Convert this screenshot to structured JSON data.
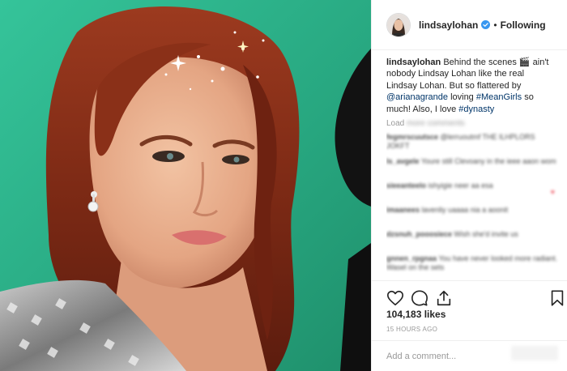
{
  "post": {
    "username": "lindsaylohan",
    "follow_status": "Following",
    "separator": "•",
    "verified_color": "#3897f0"
  },
  "caption": {
    "username": "lindsaylohan",
    "text_1": "Behind the scenes",
    "emoji": "🎬",
    "text_2": "ain't nobody Lindsay Lohan like the real Lindsay Lohan. But so flattered by",
    "mention": "@arianagrande",
    "text_3": "loving",
    "hashtag_1": "#MeanGirls",
    "text_4": "so much! Also, I love",
    "hashtag_2": "#dynasty"
  },
  "comments": {
    "load_label": "Load",
    "load_rest": "more comments",
    "items": [
      {
        "user": "fegmrscuutsce",
        "text": "@lerruoutmf THE ILHPLORS JOKFT"
      },
      {
        "user": "ls_avgele",
        "text": "Youre still Clevoany in the ieee aaon wom"
      },
      {
        "user": "sieeanteelo",
        "text": "ishyigie neer aa esa",
        "heart": "♥"
      },
      {
        "user": "imaanees",
        "text": "lavenliy uaaaa nia a aoonit"
      },
      {
        "user": "dzsnuh_pooosiece",
        "text": "Wish she'd invite us"
      },
      {
        "user": "gnnen_rpgnaa",
        "text": "You have never looked more radiant. Wasel on the sets"
      }
    ]
  },
  "actions": {
    "like_icon": "heart-outline-icon",
    "comment_icon": "comment-bubble-icon",
    "share_icon": "share-upload-icon",
    "save_icon": "bookmark-icon"
  },
  "likes": "104,183 likes",
  "timestamp": "15 HOURS AGO",
  "add_comment": {
    "placeholder": "Add a comment..."
  }
}
